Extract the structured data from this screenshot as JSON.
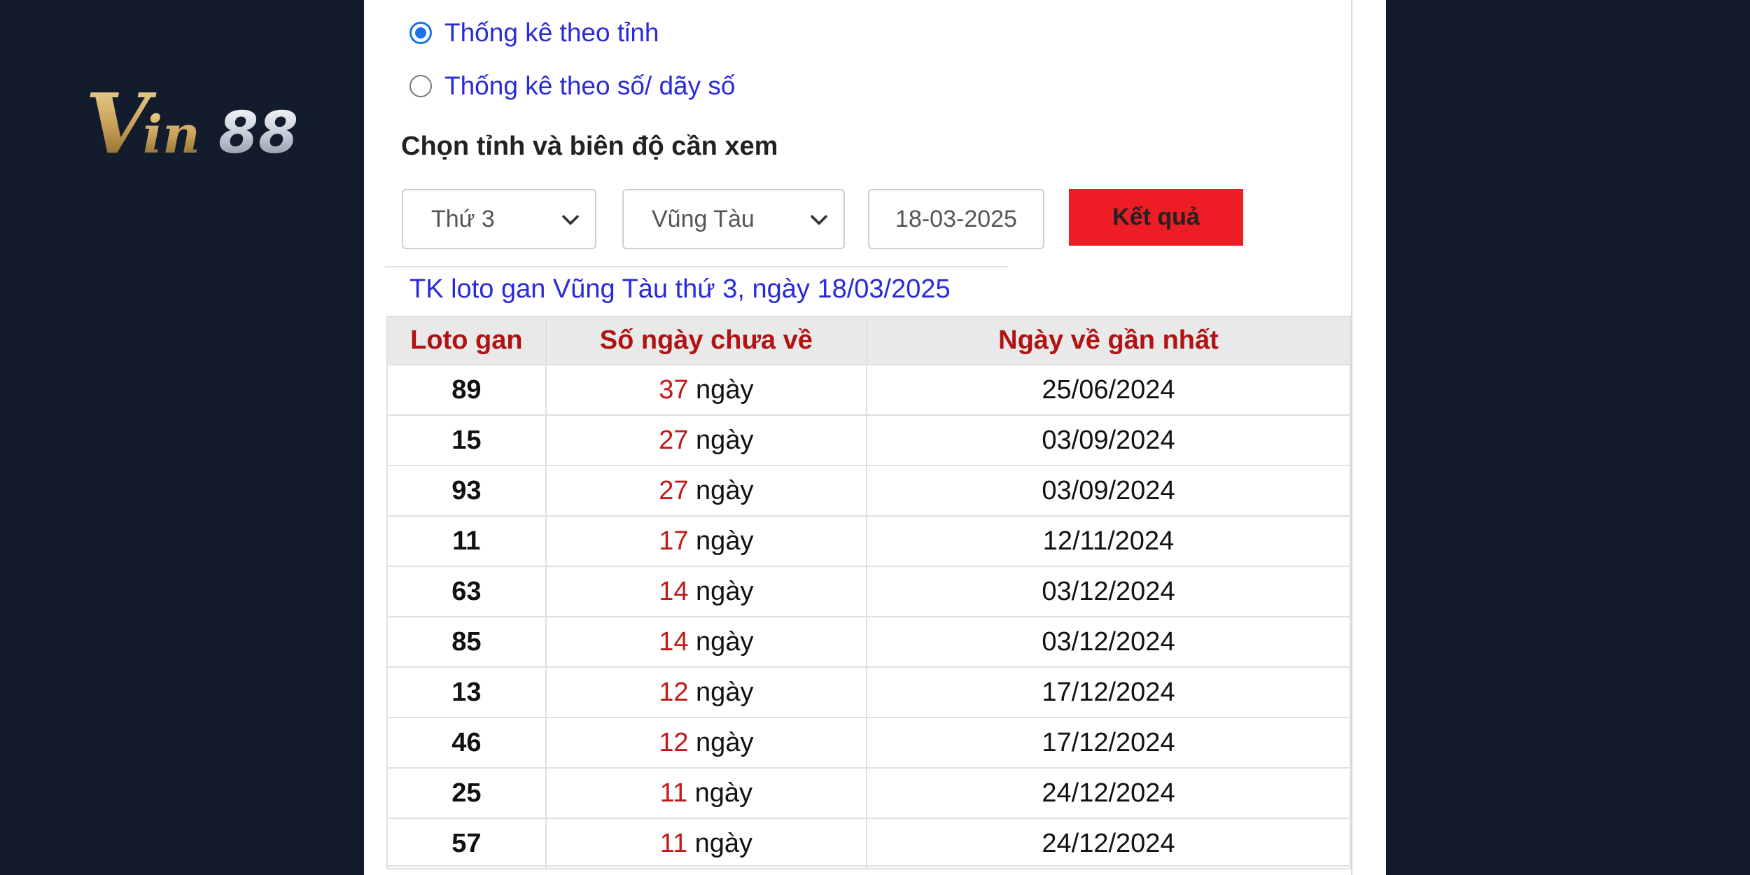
{
  "brand": {
    "logo_text": "Vin88",
    "gold": "#c9a25a",
    "silver": "#c8ced8"
  },
  "filters": {
    "options": [
      {
        "label": "Thống kê theo tỉnh",
        "checked": true
      },
      {
        "label": "Thống kê theo số/ dãy số",
        "checked": false
      }
    ],
    "section_label": "Chọn tỉnh và biên độ cần xem",
    "day_select": "Thứ 3",
    "province_select": "Vũng Tàu",
    "date_value": "18-03-2025",
    "submit_label": "Kết quả"
  },
  "result": {
    "caption": "TK loto gan Vũng Tàu thứ 3, ngày 18/03/2025",
    "columns": [
      "Loto gan",
      "Số ngày chưa về",
      "Ngày về gần nhất"
    ],
    "day_unit": "ngày",
    "rows": [
      {
        "loto": "89",
        "days": "37",
        "last": "25/06/2024"
      },
      {
        "loto": "15",
        "days": "27",
        "last": "03/09/2024"
      },
      {
        "loto": "93",
        "days": "27",
        "last": "03/09/2024"
      },
      {
        "loto": "11",
        "days": "17",
        "last": "12/11/2024"
      },
      {
        "loto": "63",
        "days": "14",
        "last": "03/12/2024"
      },
      {
        "loto": "85",
        "days": "14",
        "last": "03/12/2024"
      },
      {
        "loto": "13",
        "days": "12",
        "last": "17/12/2024"
      },
      {
        "loto": "46",
        "days": "12",
        "last": "17/12/2024"
      },
      {
        "loto": "25",
        "days": "11",
        "last": "24/12/2024"
      },
      {
        "loto": "57",
        "days": "11",
        "last": "24/12/2024"
      }
    ]
  },
  "colors": {
    "background": "#131c2c",
    "link_blue": "#2a2ad8",
    "header_red": "#b11212",
    "button_red": "#ee1c25"
  }
}
